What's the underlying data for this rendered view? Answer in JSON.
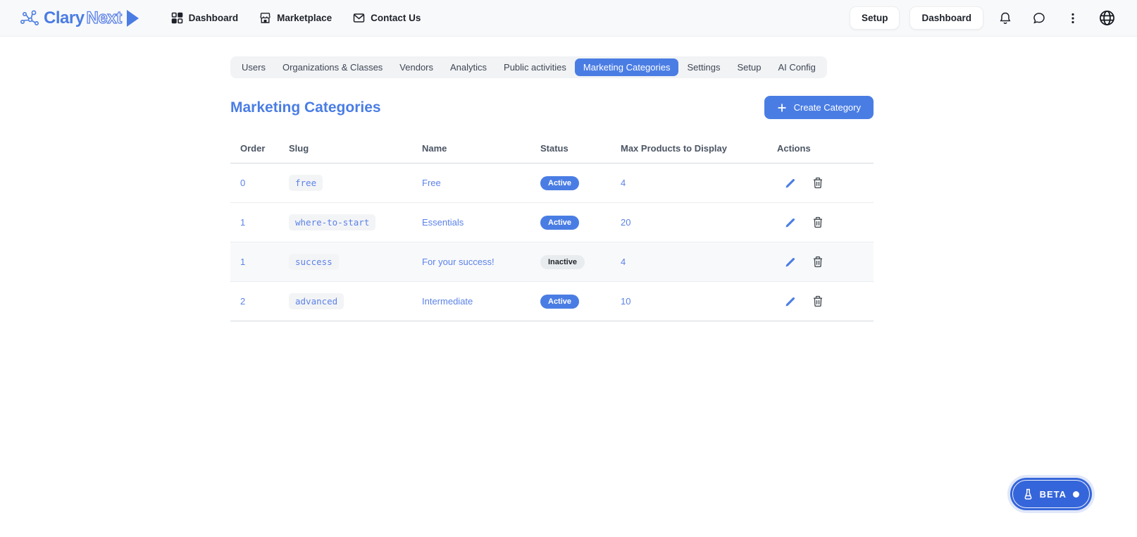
{
  "brand": {
    "name_primary": "Clary",
    "name_secondary": "Next"
  },
  "navbar": {
    "links": [
      {
        "label": "Dashboard",
        "icon": "grid-icon"
      },
      {
        "label": "Marketplace",
        "icon": "store-icon"
      },
      {
        "label": "Contact Us",
        "icon": "mail-icon"
      }
    ],
    "setup_button": "Setup",
    "dashboard_button": "Dashboard",
    "icons": [
      "bell-icon",
      "chat-icon",
      "kebab-menu-icon",
      "globe-icon"
    ]
  },
  "tabs": {
    "items": [
      {
        "label": "Users"
      },
      {
        "label": "Organizations & Classes"
      },
      {
        "label": "Vendors"
      },
      {
        "label": "Analytics"
      },
      {
        "label": "Public activities"
      },
      {
        "label": "Marketing Categories"
      },
      {
        "label": "Settings"
      },
      {
        "label": "Setup"
      },
      {
        "label": "AI Config"
      }
    ],
    "active_index": 5
  },
  "page": {
    "title": "Marketing Categories",
    "create_button_label": "Create Category"
  },
  "table": {
    "columns": [
      "Order",
      "Slug",
      "Name",
      "Status",
      "Max Products to Display",
      "Actions"
    ],
    "rows": [
      {
        "order": "0",
        "slug": "free",
        "name": "Free",
        "status": "Active",
        "max_products": "4"
      },
      {
        "order": "1",
        "slug": "where-to-start",
        "name": "Essentials",
        "status": "Active",
        "max_products": "20"
      },
      {
        "order": "1",
        "slug": "success",
        "name": "For your success!",
        "status": "Inactive",
        "max_products": "4"
      },
      {
        "order": "2",
        "slug": "advanced",
        "name": "Intermediate",
        "status": "Active",
        "max_products": "10"
      }
    ]
  },
  "beta": {
    "label": "BETA"
  },
  "colors": {
    "accent": "#4a7de4",
    "accent_text": "#5b82e8",
    "beta_bg": "#3565da",
    "navbar_bg": "#f8f9fa",
    "tabstrip_bg": "#f1f3f5",
    "inactive_badge_bg": "#e9ecef"
  }
}
